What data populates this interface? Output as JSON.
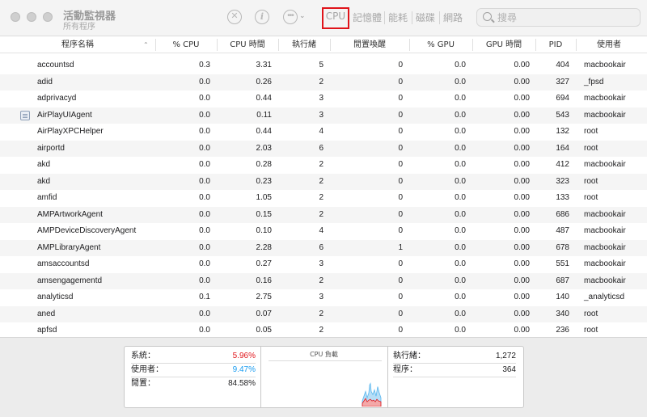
{
  "window": {
    "title": "活動監視器",
    "subtitle": "所有程序"
  },
  "toolbar": {
    "stop_icon": "✕",
    "info_icon": "i",
    "more_icon": "•••",
    "more_chevron": "⌄",
    "tabs": [
      "CPU",
      "記憶體",
      "能耗",
      "磁碟",
      "網路"
    ],
    "selected_tab": "CPU",
    "search_placeholder": "搜尋"
  },
  "table": {
    "columns": [
      "程序名稱",
      "% CPU",
      "CPU 時間",
      "執行緒",
      "閒置喚醒",
      "% GPU",
      "GPU 時間",
      "PID",
      "使用者"
    ],
    "sort_indicator": "⌃",
    "rows": [
      {
        "name": "accountsd",
        "cpu": "0.3",
        "cpu_time": "3.31",
        "threads": "5",
        "idle_wake": "0",
        "gpu": "0.0",
        "gpu_time": "0.00",
        "pid": "404",
        "user": "macbookair"
      },
      {
        "name": "adid",
        "cpu": "0.0",
        "cpu_time": "0.26",
        "threads": "2",
        "idle_wake": "0",
        "gpu": "0.0",
        "gpu_time": "0.00",
        "pid": "327",
        "user": "_fpsd"
      },
      {
        "name": "adprivacyd",
        "cpu": "0.0",
        "cpu_time": "0.44",
        "threads": "3",
        "idle_wake": "0",
        "gpu": "0.0",
        "gpu_time": "0.00",
        "pid": "694",
        "user": "macbookair"
      },
      {
        "name": "AirPlayUIAgent",
        "cpu": "0.0",
        "cpu_time": "0.11",
        "threads": "3",
        "idle_wake": "0",
        "gpu": "0.0",
        "gpu_time": "0.00",
        "pid": "543",
        "user": "macbookair",
        "icon": "app-list-icon"
      },
      {
        "name": "AirPlayXPCHelper",
        "cpu": "0.0",
        "cpu_time": "0.44",
        "threads": "4",
        "idle_wake": "0",
        "gpu": "0.0",
        "gpu_time": "0.00",
        "pid": "132",
        "user": "root"
      },
      {
        "name": "airportd",
        "cpu": "0.0",
        "cpu_time": "2.03",
        "threads": "6",
        "idle_wake": "0",
        "gpu": "0.0",
        "gpu_time": "0.00",
        "pid": "164",
        "user": "root"
      },
      {
        "name": "akd",
        "cpu": "0.0",
        "cpu_time": "0.28",
        "threads": "2",
        "idle_wake": "0",
        "gpu": "0.0",
        "gpu_time": "0.00",
        "pid": "412",
        "user": "macbookair"
      },
      {
        "name": "akd",
        "cpu": "0.0",
        "cpu_time": "0.23",
        "threads": "2",
        "idle_wake": "0",
        "gpu": "0.0",
        "gpu_time": "0.00",
        "pid": "323",
        "user": "root"
      },
      {
        "name": "amfid",
        "cpu": "0.0",
        "cpu_time": "1.05",
        "threads": "2",
        "idle_wake": "0",
        "gpu": "0.0",
        "gpu_time": "0.00",
        "pid": "133",
        "user": "root"
      },
      {
        "name": "AMPArtworkAgent",
        "cpu": "0.0",
        "cpu_time": "0.15",
        "threads": "2",
        "idle_wake": "0",
        "gpu": "0.0",
        "gpu_time": "0.00",
        "pid": "686",
        "user": "macbookair"
      },
      {
        "name": "AMPDeviceDiscoveryAgent",
        "cpu": "0.0",
        "cpu_time": "0.10",
        "threads": "4",
        "idle_wake": "0",
        "gpu": "0.0",
        "gpu_time": "0.00",
        "pid": "487",
        "user": "macbookair"
      },
      {
        "name": "AMPLibraryAgent",
        "cpu": "0.0",
        "cpu_time": "2.28",
        "threads": "6",
        "idle_wake": "1",
        "gpu": "0.0",
        "gpu_time": "0.00",
        "pid": "678",
        "user": "macbookair"
      },
      {
        "name": "amsaccountsd",
        "cpu": "0.0",
        "cpu_time": "0.27",
        "threads": "3",
        "idle_wake": "0",
        "gpu": "0.0",
        "gpu_time": "0.00",
        "pid": "551",
        "user": "macbookair"
      },
      {
        "name": "amsengagementd",
        "cpu": "0.0",
        "cpu_time": "0.16",
        "threads": "2",
        "idle_wake": "0",
        "gpu": "0.0",
        "gpu_time": "0.00",
        "pid": "687",
        "user": "macbookair"
      },
      {
        "name": "analyticsd",
        "cpu": "0.1",
        "cpu_time": "2.75",
        "threads": "3",
        "idle_wake": "0",
        "gpu": "0.0",
        "gpu_time": "0.00",
        "pid": "140",
        "user": "_analyticsd"
      },
      {
        "name": "aned",
        "cpu": "0.0",
        "cpu_time": "0.07",
        "threads": "2",
        "idle_wake": "0",
        "gpu": "0.0",
        "gpu_time": "0.00",
        "pid": "340",
        "user": "root"
      },
      {
        "name": "apfsd",
        "cpu": "0.0",
        "cpu_time": "0.05",
        "threads": "2",
        "idle_wake": "0",
        "gpu": "0.0",
        "gpu_time": "0.00",
        "pid": "236",
        "user": "root"
      }
    ]
  },
  "summary": {
    "system_label": "系統：",
    "system_value": "5.96%",
    "user_label": "使用者：",
    "user_value": "9.47%",
    "idle_label": "閒置：",
    "idle_value": "84.58%",
    "graph_title": "CPU 負載",
    "threads_label": "執行緒：",
    "threads_value": "1,272",
    "processes_label": "程序：",
    "processes_value": "364"
  },
  "colors": {
    "highlight_box": "#e0141a",
    "system_color": "#e0141a",
    "user_color": "#1a9cf0"
  }
}
